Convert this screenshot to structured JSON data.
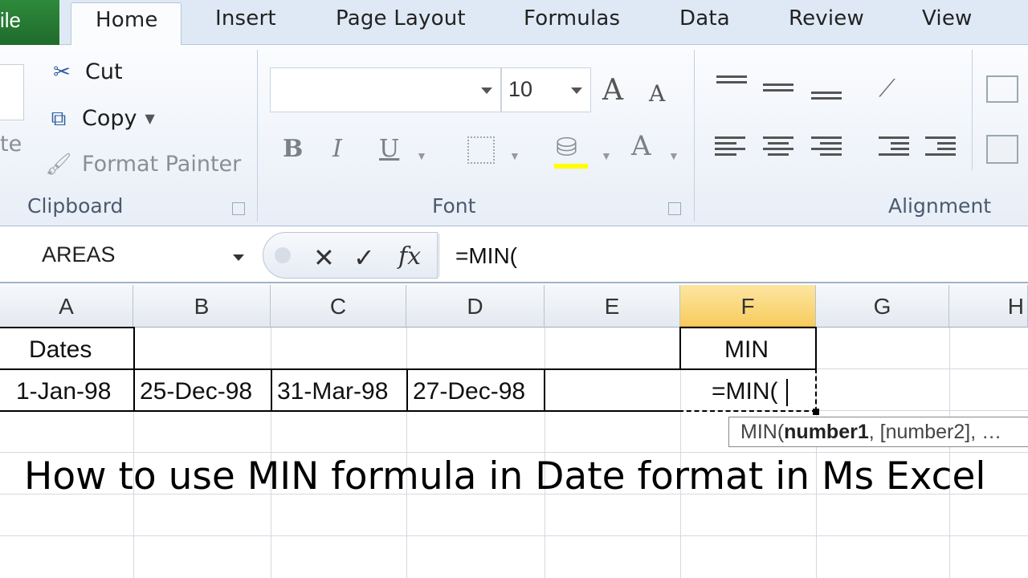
{
  "tabs": {
    "file": "ile",
    "items": [
      "Home",
      "Insert",
      "Page Layout",
      "Formulas",
      "Data",
      "Review",
      "View"
    ]
  },
  "clipboard": {
    "paste": "te",
    "cut": "Cut",
    "copy": "Copy",
    "format_painter": "Format Painter",
    "group_label": "Clipboard"
  },
  "font": {
    "font_name": "",
    "font_size": "10",
    "bold": "B",
    "italic": "I",
    "underline": "U",
    "group_label": "Font"
  },
  "alignment": {
    "group_label": "Alignment"
  },
  "formula_bar": {
    "name_box": "AREAS",
    "cancel": "✕",
    "enter": "✓",
    "fx": "fx",
    "formula": "=MIN("
  },
  "columns": [
    "A",
    "B",
    "C",
    "D",
    "E",
    "F",
    "G",
    "H"
  ],
  "selected_column": "F",
  "cells": {
    "a1": "Dates",
    "f1": "MIN",
    "a2": "1-Jan-98",
    "b2": "25-Dec-98",
    "c2": "31-Mar-98",
    "d2": "27-Dec-98",
    "f2": "=MIN("
  },
  "tooltip": {
    "fn": "MIN(",
    "arg1": "number1",
    "rest": ", [number2], …"
  },
  "caption": "How to use MIN formula in Date format in Ms Excel",
  "colors": {
    "file_tab": "#1f6b2b",
    "selected_header": "#f7cc5d",
    "ribbon_bg": "#e8eef7"
  }
}
